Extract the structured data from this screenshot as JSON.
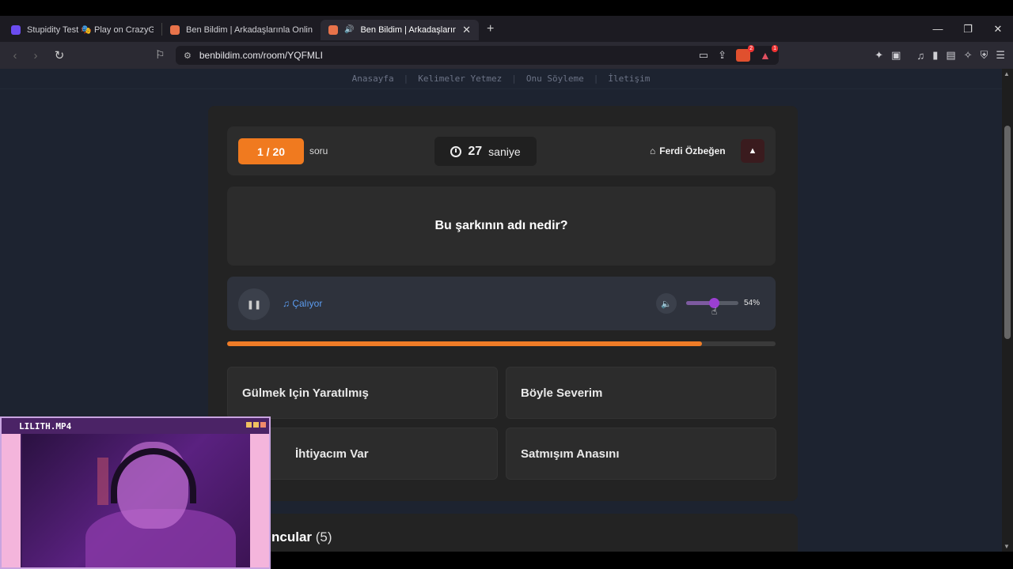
{
  "browser": {
    "tabs": [
      {
        "title": "Stupidity Test 🎭 Play on CrazyGames",
        "active": false,
        "favicon_color": "#6b4cf0"
      },
      {
        "title": "Ben Bildim | Arkadaşlarınla Online Bilgi",
        "active": false,
        "favicon_color": "#e8734a"
      },
      {
        "title": "Ben Bildim | Arkadaşlarınla Online",
        "active": true,
        "favicon_color": "#e8734a"
      }
    ],
    "url": "benbildim.com/room/YQFMLI",
    "shield_badge": "2",
    "alert_badge": "1"
  },
  "site_nav": [
    "Anasayfa",
    "Kelimeler Yetmez",
    "Onu Söyleme",
    "İletişim"
  ],
  "game": {
    "counter": "1 / 20",
    "counter_unit": "soru",
    "timer_value": "27",
    "timer_unit": "saniye",
    "author": "Ferdi Özbeğen",
    "question": "Bu şarkının adı nedir?",
    "player_status": "Çalıyor",
    "volume_label": "54%",
    "volume_value": 0.54,
    "time_progress": 0.866,
    "answers": [
      "Gülmek Için Yaratılmış",
      "Böyle Severim",
      "İhtiyacım Var",
      "Satmışım Anasını"
    ]
  },
  "players": {
    "title_partial": "ncular",
    "count": "(5)"
  },
  "cam": {
    "title": "LILITH.MP4"
  },
  "colors": {
    "accent_orange": "#f07a1f",
    "accent_purple": "#9b3fd1",
    "playing_blue": "#5b9cf0"
  }
}
